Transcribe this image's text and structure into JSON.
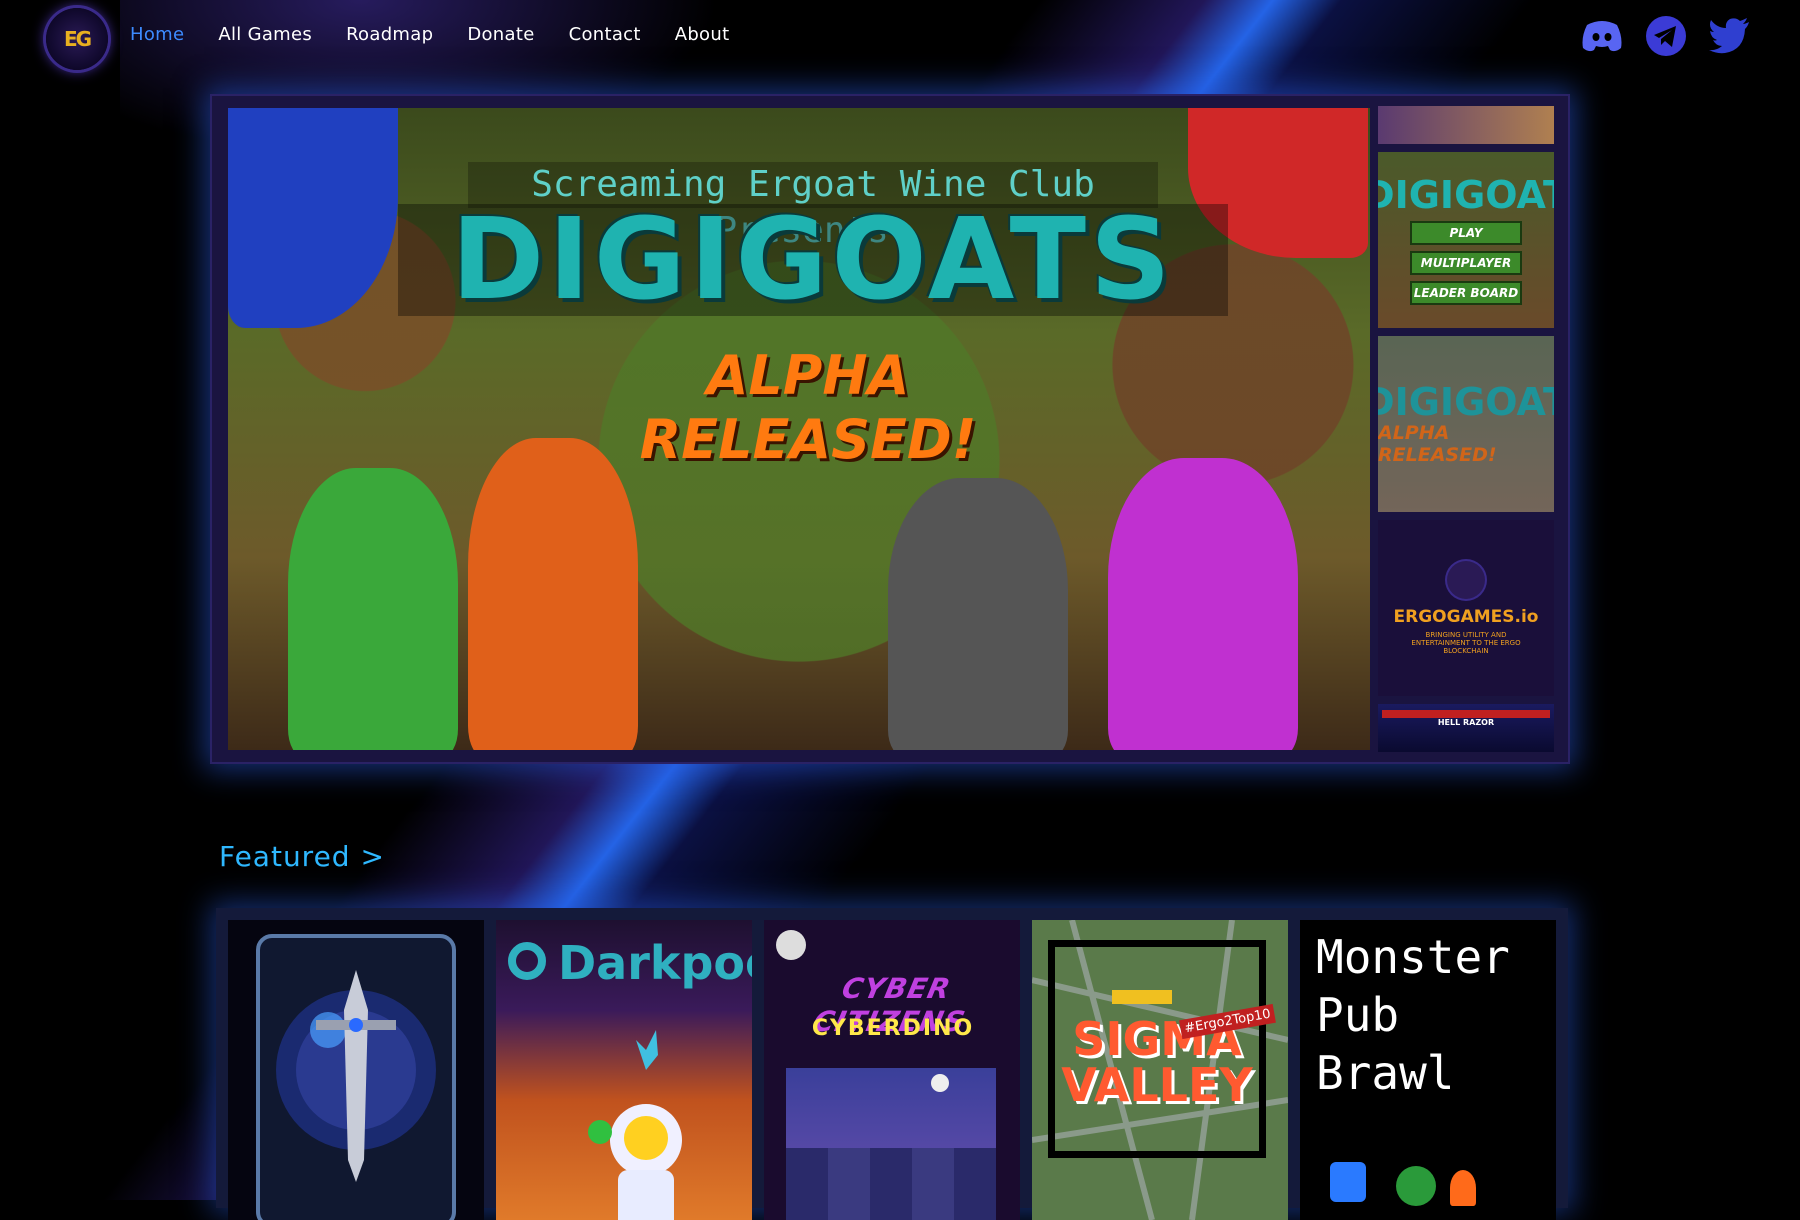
{
  "nav": {
    "logo_text": "EG",
    "links": [
      {
        "label": "Home",
        "active": true
      },
      {
        "label": "All Games",
        "active": false
      },
      {
        "label": "Roadmap",
        "active": false
      },
      {
        "label": "Donate",
        "active": false
      },
      {
        "label": "Contact",
        "active": false
      },
      {
        "label": "About",
        "active": false
      }
    ],
    "socials": [
      {
        "icon": "discord-icon",
        "color": "#5865f2"
      },
      {
        "icon": "telegram-icon",
        "color": "#4a4adf"
      },
      {
        "icon": "twitter-icon",
        "color": "#2f3fd0"
      }
    ]
  },
  "hero": {
    "pre_title": "Screaming Ergoat Wine Club Presents:",
    "title": "DIGIGOATS",
    "subtitle": "ALPHA RELEASED!",
    "thumbs": {
      "t2_title": "DIGIGOAT",
      "t2_buttons": [
        "PLAY",
        "MULTIPLAYER",
        "LEADER BOARD"
      ],
      "t3_title": "DIGIGOAT",
      "t3_sub": "ALPHA RELEASED!",
      "t4_brand": "ERGOGAMES.io",
      "t4_tagline": "BRINGING UTILITY AND ENTERTAINMENT TO THE ERGO BLOCKCHAIN",
      "t5_hud": "HELL RAZOR"
    }
  },
  "featured": {
    "title": "Featured >",
    "cards": [
      {
        "name": "card-sword"
      },
      {
        "name": "Darkpool"
      },
      {
        "title": "CYBER CITIZENS",
        "subtitle": "CYBERDINO"
      },
      {
        "title_line1": "SIGMA",
        "title_line2": "VALLEY",
        "tag": "#Ergo2Top10"
      },
      {
        "lines": [
          "Monster",
          "Pub",
          "Brawl"
        ]
      }
    ]
  },
  "colors": {
    "accent": "#3d8bff",
    "featured_title": "#2fb8ff",
    "glow": "#285adc"
  }
}
